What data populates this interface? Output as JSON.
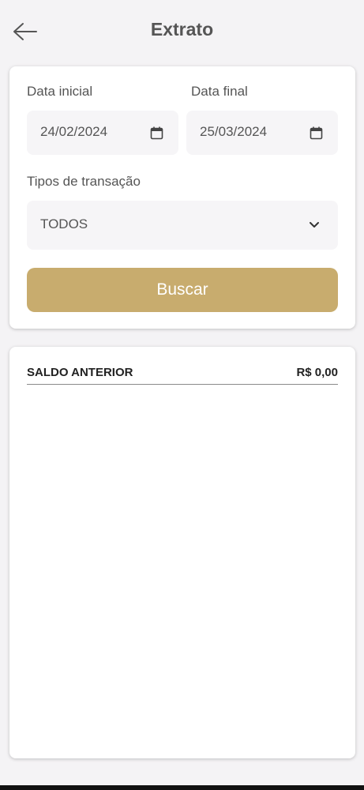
{
  "header": {
    "title": "Extrato",
    "back_icon": "arrow-left-icon"
  },
  "filters": {
    "start_date": {
      "label": "Data inicial",
      "value": "24/02/2024",
      "icon": "calendar-icon"
    },
    "end_date": {
      "label": "Data final",
      "value": "25/03/2024",
      "icon": "calendar-icon"
    },
    "transaction_type": {
      "label": "Tipos de transação",
      "value": "TODOS",
      "icon": "chevron-down-icon"
    },
    "search_label": "Buscar"
  },
  "statement": {
    "previous_balance_label": "SALDO ANTERIOR",
    "previous_balance_value": "R$ 0,00"
  },
  "colors": {
    "accent": "#c8ac6e",
    "background": "#f4f3f5",
    "card": "#ffffff",
    "text": "#555555"
  }
}
